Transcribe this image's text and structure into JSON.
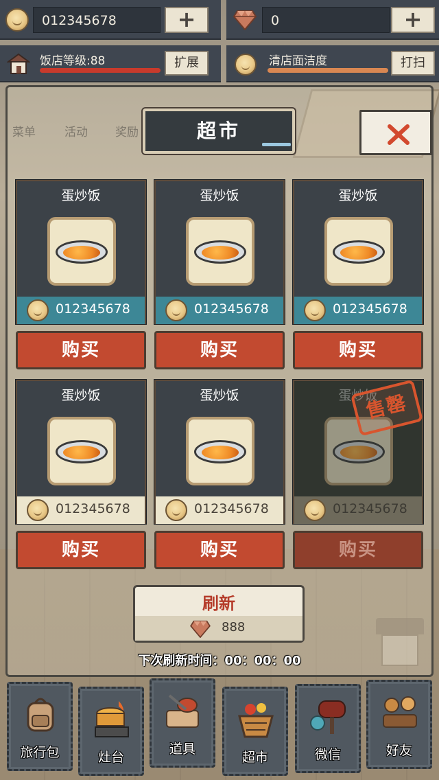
{
  "hud": {
    "coins": "012345678",
    "gems": "0",
    "plus_label": "+",
    "level_label": "饭店等级:88",
    "expand_label": "扩展",
    "cleanliness_label": "清店面洁度",
    "clean_button_label": "打扫"
  },
  "side_nav": {
    "menu": "菜单",
    "activity": "活动",
    "reward": "奖励"
  },
  "dialog": {
    "title": "超市"
  },
  "items": [
    {
      "name": "蛋炒饭",
      "price": "012345678",
      "buy_label": "购买",
      "price_style": "teal",
      "sold_out": false
    },
    {
      "name": "蛋炒饭",
      "price": "012345678",
      "buy_label": "购买",
      "price_style": "teal",
      "sold_out": false
    },
    {
      "name": "蛋炒饭",
      "price": "012345678",
      "buy_label": "购买",
      "price_style": "teal",
      "sold_out": false
    },
    {
      "name": "蛋炒饭",
      "price": "012345678",
      "buy_label": "购买",
      "price_style": "cream",
      "sold_out": false
    },
    {
      "name": "蛋炒饭",
      "price": "012345678",
      "buy_label": "购买",
      "price_style": "cream",
      "sold_out": false
    },
    {
      "name": "蛋炒饭",
      "price": "012345678",
      "buy_label": "购买",
      "price_style": "cream",
      "sold_out": true,
      "sold_stamp": "售罄"
    }
  ],
  "refresh": {
    "label": "刷新",
    "cost": "888",
    "next_time": "下次刷新时间：00：00：00"
  },
  "bottom_nav": [
    {
      "label": "旅行包",
      "icon": "backpack-icon"
    },
    {
      "label": "灶台",
      "icon": "stove-icon"
    },
    {
      "label": "道具",
      "icon": "tools-icon"
    },
    {
      "label": "超市",
      "icon": "market-basket-icon"
    },
    {
      "label": "微信",
      "icon": "mailbox-icon"
    },
    {
      "label": "好友",
      "icon": "friends-icon"
    }
  ],
  "colors": {
    "hud_bg": "#3f4650",
    "buy_button": "#c24a30",
    "price_teal": "#3d8796",
    "price_cream": "#ece5cd",
    "refresh_text": "#b53c2a",
    "stamp": "#d8552e"
  }
}
